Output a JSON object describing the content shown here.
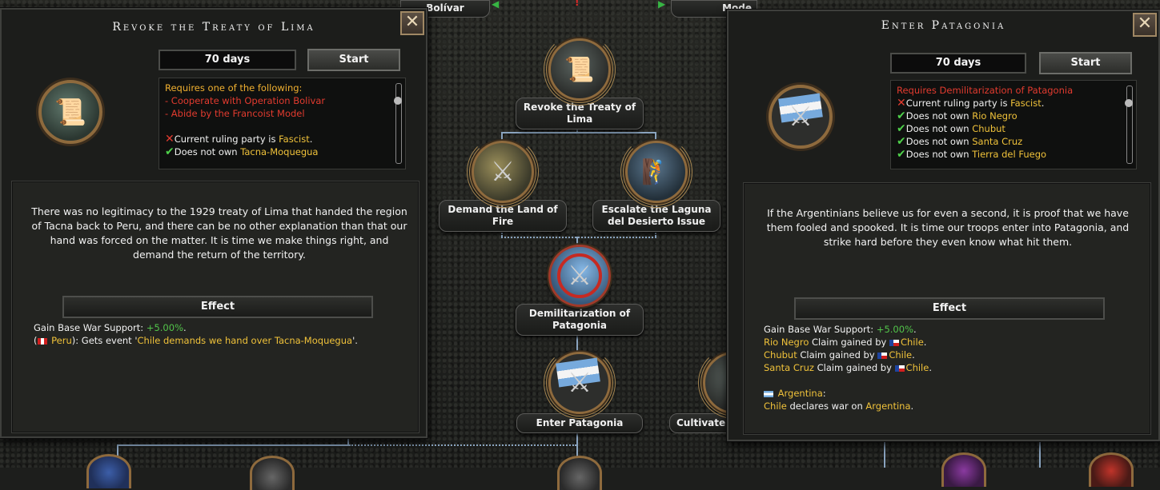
{
  "top_tabs": [
    {
      "label": "Bolívar"
    },
    {
      "label": "Mode"
    }
  ],
  "tree": {
    "nodes": [
      {
        "id": "revoke",
        "label": "Revoke the Treaty of Lima",
        "icon": "scroll-icon"
      },
      {
        "id": "land_of_fire",
        "label": "Demand the Land of Fire",
        "icon": "swords-island-icon"
      },
      {
        "id": "laguna",
        "label": "Escalate the Laguna del Desierto Issue",
        "icon": "climber-icon"
      },
      {
        "id": "demil",
        "label": "Demilitarization of Patagonia",
        "icon": "demilitarized-map-icon"
      },
      {
        "id": "enter_pat",
        "label": "Enter Patagonia",
        "icon": "argentina-swords-icon"
      },
      {
        "id": "cultivate",
        "label": "Cultivate",
        "icon": "wheat-icon"
      }
    ]
  },
  "left_panel": {
    "title": "Revoke the Treaty of Lima",
    "close_label": "✕",
    "days": "70 days",
    "start_label": "Start",
    "icon": "scroll-icon",
    "requirements": [
      {
        "parts": [
          {
            "t": "Requires one of the following:",
            "c": "orange"
          }
        ]
      },
      {
        "parts": [
          {
            "t": "- Cooperate with Operation Bolivar",
            "c": "red"
          }
        ]
      },
      {
        "parts": [
          {
            "t": "- Abide by the Francoist Model",
            "c": "red"
          }
        ]
      },
      {
        "parts": [
          {
            "t": "",
            "c": ""
          }
        ]
      },
      {
        "mark": "x",
        "parts": [
          {
            "t": "Current ruling party is ",
            "c": ""
          },
          {
            "t": "Fascist",
            "c": "yellow"
          },
          {
            "t": ".",
            "c": ""
          }
        ]
      },
      {
        "mark": "check",
        "parts": [
          {
            "t": "Does not own ",
            "c": ""
          },
          {
            "t": "Tacna-Moquegua",
            "c": "yellow"
          }
        ]
      }
    ],
    "description": "There was no legitimacy to the 1929 treaty of Lima that handed the region of Tacna back to Peru, and there can be no other explanation than that our hand was forced on the matter. It is time we make things right, and demand the return of the territory.",
    "effect_label": "Effect",
    "effects": [
      {
        "parts": [
          {
            "t": "Gain Base War Support: ",
            "c": ""
          },
          {
            "t": "+5.00%",
            "c": "green"
          },
          {
            "t": ".",
            "c": ""
          }
        ]
      },
      {
        "parts": [
          {
            "t": "(",
            "c": ""
          },
          {
            "flag": "pe"
          },
          {
            "t": " Peru",
            "c": "yellow"
          },
          {
            "t": "): Gets event '",
            "c": ""
          },
          {
            "t": "Chile demands we hand over Tacna-Moquegua",
            "c": "yellow"
          },
          {
            "t": "'.",
            "c": ""
          }
        ]
      }
    ]
  },
  "right_panel": {
    "title": "Enter Patagonia",
    "close_label": "✕",
    "days": "70 days",
    "start_label": "Start",
    "icon": "argentina-swords-icon",
    "requirements": [
      {
        "parts": [
          {
            "t": "Requires Demilitarization of Patagonia",
            "c": "red"
          }
        ]
      },
      {
        "mark": "x",
        "parts": [
          {
            "t": "Current ruling party is ",
            "c": ""
          },
          {
            "t": "Fascist",
            "c": "yellow"
          },
          {
            "t": ".",
            "c": ""
          }
        ]
      },
      {
        "mark": "check",
        "parts": [
          {
            "t": "Does not own ",
            "c": ""
          },
          {
            "t": "Rio Negro",
            "c": "yellow"
          }
        ]
      },
      {
        "mark": "check",
        "parts": [
          {
            "t": "Does not own ",
            "c": ""
          },
          {
            "t": "Chubut",
            "c": "yellow"
          }
        ]
      },
      {
        "mark": "check",
        "parts": [
          {
            "t": "Does not own ",
            "c": ""
          },
          {
            "t": "Santa Cruz",
            "c": "yellow"
          }
        ]
      },
      {
        "mark": "check",
        "parts": [
          {
            "t": "Does not own ",
            "c": ""
          },
          {
            "t": "Tierra del Fuego",
            "c": "yellow"
          }
        ]
      }
    ],
    "description": "If the Argentinians believe us for even a second, it is proof that we have them fooled and spooked. It is time our troops enter into Patagonia, and strike hard before they even know what hit them.",
    "effect_label": "Effect",
    "effects": [
      {
        "parts": [
          {
            "t": "Gain Base War Support: ",
            "c": ""
          },
          {
            "t": "+5.00%",
            "c": "green"
          },
          {
            "t": ".",
            "c": ""
          }
        ]
      },
      {
        "parts": [
          {
            "t": "Rio Negro",
            "c": "yellow"
          },
          {
            "t": " Claim gained by ",
            "c": ""
          },
          {
            "flag": "cl"
          },
          {
            "t": "Chile",
            "c": "yellow"
          },
          {
            "t": ".",
            "c": ""
          }
        ]
      },
      {
        "parts": [
          {
            "t": "Chubut",
            "c": "yellow"
          },
          {
            "t": " Claim gained by ",
            "c": ""
          },
          {
            "flag": "cl"
          },
          {
            "t": "Chile",
            "c": "yellow"
          },
          {
            "t": ".",
            "c": ""
          }
        ]
      },
      {
        "parts": [
          {
            "t": "Santa Cruz",
            "c": "yellow"
          },
          {
            "t": " Claim gained by ",
            "c": ""
          },
          {
            "flag": "cl"
          },
          {
            "t": "Chile",
            "c": "yellow"
          },
          {
            "t": ".",
            "c": ""
          }
        ]
      },
      {
        "parts": [
          {
            "t": "",
            "c": ""
          }
        ]
      },
      {
        "parts": [
          {
            "flag": "ar"
          },
          {
            "t": " Argentina",
            "c": "yellow"
          },
          {
            "t": ":",
            "c": ""
          }
        ]
      },
      {
        "parts": [
          {
            "t": "Chile",
            "c": "yellow"
          },
          {
            "t": " declares war on ",
            "c": ""
          },
          {
            "t": "Argentina",
            "c": "yellow"
          },
          {
            "t": ".",
            "c": ""
          }
        ]
      }
    ]
  }
}
